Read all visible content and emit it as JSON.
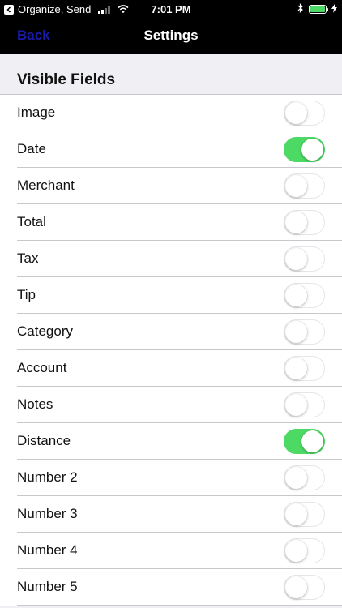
{
  "status_bar": {
    "back_app": "Organize, Send",
    "time": "7:01 PM",
    "battery_color": "#4cd964"
  },
  "nav": {
    "back_label": "Back",
    "title": "Settings"
  },
  "section": {
    "title": "Visible Fields"
  },
  "fields": [
    {
      "label": "Image",
      "on": false
    },
    {
      "label": "Date",
      "on": true
    },
    {
      "label": "Merchant",
      "on": false
    },
    {
      "label": "Total",
      "on": false
    },
    {
      "label": "Tax",
      "on": false
    },
    {
      "label": "Tip",
      "on": false
    },
    {
      "label": "Category",
      "on": false
    },
    {
      "label": "Account",
      "on": false
    },
    {
      "label": "Notes",
      "on": false
    },
    {
      "label": "Distance",
      "on": true
    },
    {
      "label": "Number 2",
      "on": false
    },
    {
      "label": "Number 3",
      "on": false
    },
    {
      "label": "Number 4",
      "on": false
    },
    {
      "label": "Number 5",
      "on": false
    }
  ],
  "colors": {
    "switch_on": "#4cd964",
    "back_text": "#1a1aa6"
  }
}
